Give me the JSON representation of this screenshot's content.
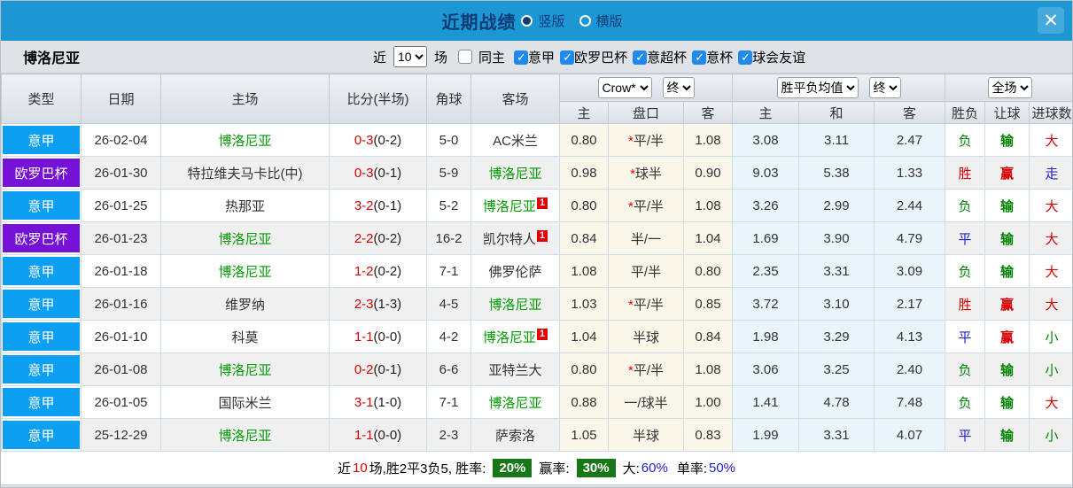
{
  "titlebar": {
    "title": "近期战绩",
    "layout_options": [
      {
        "label": "竖版",
        "selected": true
      },
      {
        "label": "横版",
        "selected": false
      }
    ],
    "close_label": "✕",
    "bar_color": "#1d97d4"
  },
  "filterbar": {
    "team": "博洛尼亚",
    "recent_label": "近",
    "recent_count": "10",
    "matches_label": "场",
    "same_home": {
      "label": "同主",
      "checked": false
    },
    "competitions": [
      {
        "label": "意甲",
        "checked": true
      },
      {
        "label": "欧罗巴杯",
        "checked": true
      },
      {
        "label": "意超杯",
        "checked": true
      },
      {
        "label": "意杯",
        "checked": true
      },
      {
        "label": "球会友谊",
        "checked": true
      }
    ]
  },
  "table": {
    "static_headers": [
      "类型",
      "日期",
      "主场",
      "比分(半场)",
      "角球",
      "客场"
    ],
    "odds_group": {
      "bookmaker": "Crow*",
      "time": "终",
      "subheaders": [
        "主",
        "盘口",
        "客"
      ]
    },
    "mean_group": {
      "name": "胜平负均值",
      "time": "终",
      "subheaders": [
        "主",
        "和",
        "客"
      ]
    },
    "result_group": {
      "scope": "全场",
      "subheaders": [
        "胜负",
        "让球",
        "进球数"
      ]
    },
    "rows": [
      {
        "type": "意甲",
        "type_color": "blue",
        "date": "26-02-04",
        "home": "博洛尼亚",
        "home_focus": true,
        "score": "0-3",
        "half": "(0-2)",
        "corner": "5-0",
        "away": "AC米兰",
        "away_focus": false,
        "away_badge": "",
        "odds_home": "0.80",
        "handicap_star": true,
        "handicap": "平/半",
        "odds_away": "1.08",
        "mean_win": "3.08",
        "mean_draw": "3.11",
        "mean_lose": "2.47",
        "result": "负",
        "result_color": "green",
        "handicap_result": "输",
        "handicap_result_color": "green",
        "goals": "大",
        "goals_color": "red"
      },
      {
        "type": "欧罗巴杯",
        "type_color": "purple",
        "date": "26-01-30",
        "home": "特拉维夫马卡比(中)",
        "home_focus": false,
        "score": "0-3",
        "half": "(0-1)",
        "corner": "5-9",
        "away": "博洛尼亚",
        "away_focus": true,
        "away_badge": "",
        "odds_home": "0.98",
        "handicap_star": true,
        "handicap": "球半",
        "odds_away": "0.90",
        "mean_win": "9.03",
        "mean_draw": "5.38",
        "mean_lose": "1.33",
        "result": "胜",
        "result_color": "red",
        "handicap_result": "赢",
        "handicap_result_color": "red",
        "goals": "走",
        "goals_color": "blue"
      },
      {
        "type": "意甲",
        "type_color": "blue",
        "date": "26-01-25",
        "home": "热那亚",
        "home_focus": false,
        "score": "3-2",
        "half": "(0-1)",
        "corner": "5-2",
        "away": "博洛尼亚",
        "away_focus": true,
        "away_badge": "1",
        "odds_home": "0.80",
        "handicap_star": true,
        "handicap": "平/半",
        "odds_away": "1.08",
        "mean_win": "3.26",
        "mean_draw": "2.99",
        "mean_lose": "2.44",
        "result": "负",
        "result_color": "green",
        "handicap_result": "输",
        "handicap_result_color": "green",
        "goals": "大",
        "goals_color": "red"
      },
      {
        "type": "欧罗巴杯",
        "type_color": "purple",
        "date": "26-01-23",
        "home": "博洛尼亚",
        "home_focus": true,
        "score": "2-2",
        "half": "(0-2)",
        "corner": "16-2",
        "away": "凯尔特人",
        "away_focus": false,
        "away_badge": "1",
        "odds_home": "0.84",
        "handicap_star": false,
        "handicap": "半/一",
        "odds_away": "1.04",
        "mean_win": "1.69",
        "mean_draw": "3.90",
        "mean_lose": "4.79",
        "result": "平",
        "result_color": "blue",
        "handicap_result": "输",
        "handicap_result_color": "green",
        "goals": "大",
        "goals_color": "red"
      },
      {
        "type": "意甲",
        "type_color": "blue",
        "date": "26-01-18",
        "home": "博洛尼亚",
        "home_focus": true,
        "score": "1-2",
        "half": "(0-2)",
        "corner": "7-1",
        "away": "佛罗伦萨",
        "away_focus": false,
        "away_badge": "",
        "odds_home": "1.08",
        "handicap_star": false,
        "handicap": "平/半",
        "odds_away": "0.80",
        "mean_win": "2.35",
        "mean_draw": "3.31",
        "mean_lose": "3.09",
        "result": "负",
        "result_color": "green",
        "handicap_result": "输",
        "handicap_result_color": "green",
        "goals": "大",
        "goals_color": "red"
      },
      {
        "type": "意甲",
        "type_color": "blue",
        "date": "26-01-16",
        "home": "维罗纳",
        "home_focus": false,
        "score": "2-3",
        "half": "(1-3)",
        "corner": "4-5",
        "away": "博洛尼亚",
        "away_focus": true,
        "away_badge": "",
        "odds_home": "1.03",
        "handicap_star": true,
        "handicap": "平/半",
        "odds_away": "0.85",
        "mean_win": "3.72",
        "mean_draw": "3.10",
        "mean_lose": "2.17",
        "result": "胜",
        "result_color": "red",
        "handicap_result": "赢",
        "handicap_result_color": "red",
        "goals": "大",
        "goals_color": "red"
      },
      {
        "type": "意甲",
        "type_color": "blue",
        "date": "26-01-10",
        "home": "科莫",
        "home_focus": false,
        "score": "1-1",
        "half": "(0-0)",
        "corner": "4-2",
        "away": "博洛尼亚",
        "away_focus": true,
        "away_badge": "1",
        "odds_home": "1.04",
        "handicap_star": false,
        "handicap": "半球",
        "odds_away": "0.84",
        "mean_win": "1.98",
        "mean_draw": "3.29",
        "mean_lose": "4.13",
        "result": "平",
        "result_color": "blue",
        "handicap_result": "赢",
        "handicap_result_color": "red",
        "goals": "小",
        "goals_color": "green"
      },
      {
        "type": "意甲",
        "type_color": "blue",
        "date": "26-01-08",
        "home": "博洛尼亚",
        "home_focus": true,
        "score": "0-2",
        "half": "(0-1)",
        "corner": "6-6",
        "away": "亚特兰大",
        "away_focus": false,
        "away_badge": "",
        "odds_home": "0.80",
        "handicap_star": true,
        "handicap": "平/半",
        "odds_away": "1.08",
        "mean_win": "3.06",
        "mean_draw": "3.25",
        "mean_lose": "2.40",
        "result": "负",
        "result_color": "green",
        "handicap_result": "输",
        "handicap_result_color": "green",
        "goals": "小",
        "goals_color": "green"
      },
      {
        "type": "意甲",
        "type_color": "blue",
        "date": "26-01-05",
        "home": "国际米兰",
        "home_focus": false,
        "score": "3-1",
        "half": "(1-0)",
        "corner": "7-1",
        "away": "博洛尼亚",
        "away_focus": true,
        "away_badge": "",
        "odds_home": "0.88",
        "handicap_star": false,
        "handicap": "一/球半",
        "odds_away": "1.00",
        "mean_win": "1.41",
        "mean_draw": "4.78",
        "mean_lose": "7.48",
        "result": "负",
        "result_color": "green",
        "handicap_result": "输",
        "handicap_result_color": "green",
        "goals": "大",
        "goals_color": "red"
      },
      {
        "type": "意甲",
        "type_color": "blue",
        "date": "25-12-29",
        "home": "博洛尼亚",
        "home_focus": true,
        "score": "1-1",
        "half": "(0-0)",
        "corner": "2-3",
        "away": "萨索洛",
        "away_focus": false,
        "away_badge": "",
        "odds_home": "1.05",
        "handicap_star": false,
        "handicap": "半球",
        "odds_away": "0.83",
        "mean_win": "1.99",
        "mean_draw": "3.31",
        "mean_lose": "4.07",
        "result": "平",
        "result_color": "blue",
        "handicap_result": "输",
        "handicap_result_color": "green",
        "goals": "小",
        "goals_color": "green"
      }
    ]
  },
  "footer": {
    "prefix": "近",
    "count": "10",
    "summary": "场,胜2平3负5, 胜率:",
    "win_rate": "20%",
    "win_odds_label": "赢率:",
    "win_odds_rate": "30%",
    "big_label": "大:",
    "big_rate": "60%",
    "single_label": "单率:",
    "single_rate": "50%"
  },
  "colors": {
    "league_blue": "#0d9ff2",
    "league_purple": "#7612d8",
    "focus_team_green": "#009c00",
    "score_red": "#d80000",
    "result_red": "#d80000",
    "result_green": "#028402",
    "result_blue": "#2020cc",
    "pct_badge_green": "#187818"
  }
}
